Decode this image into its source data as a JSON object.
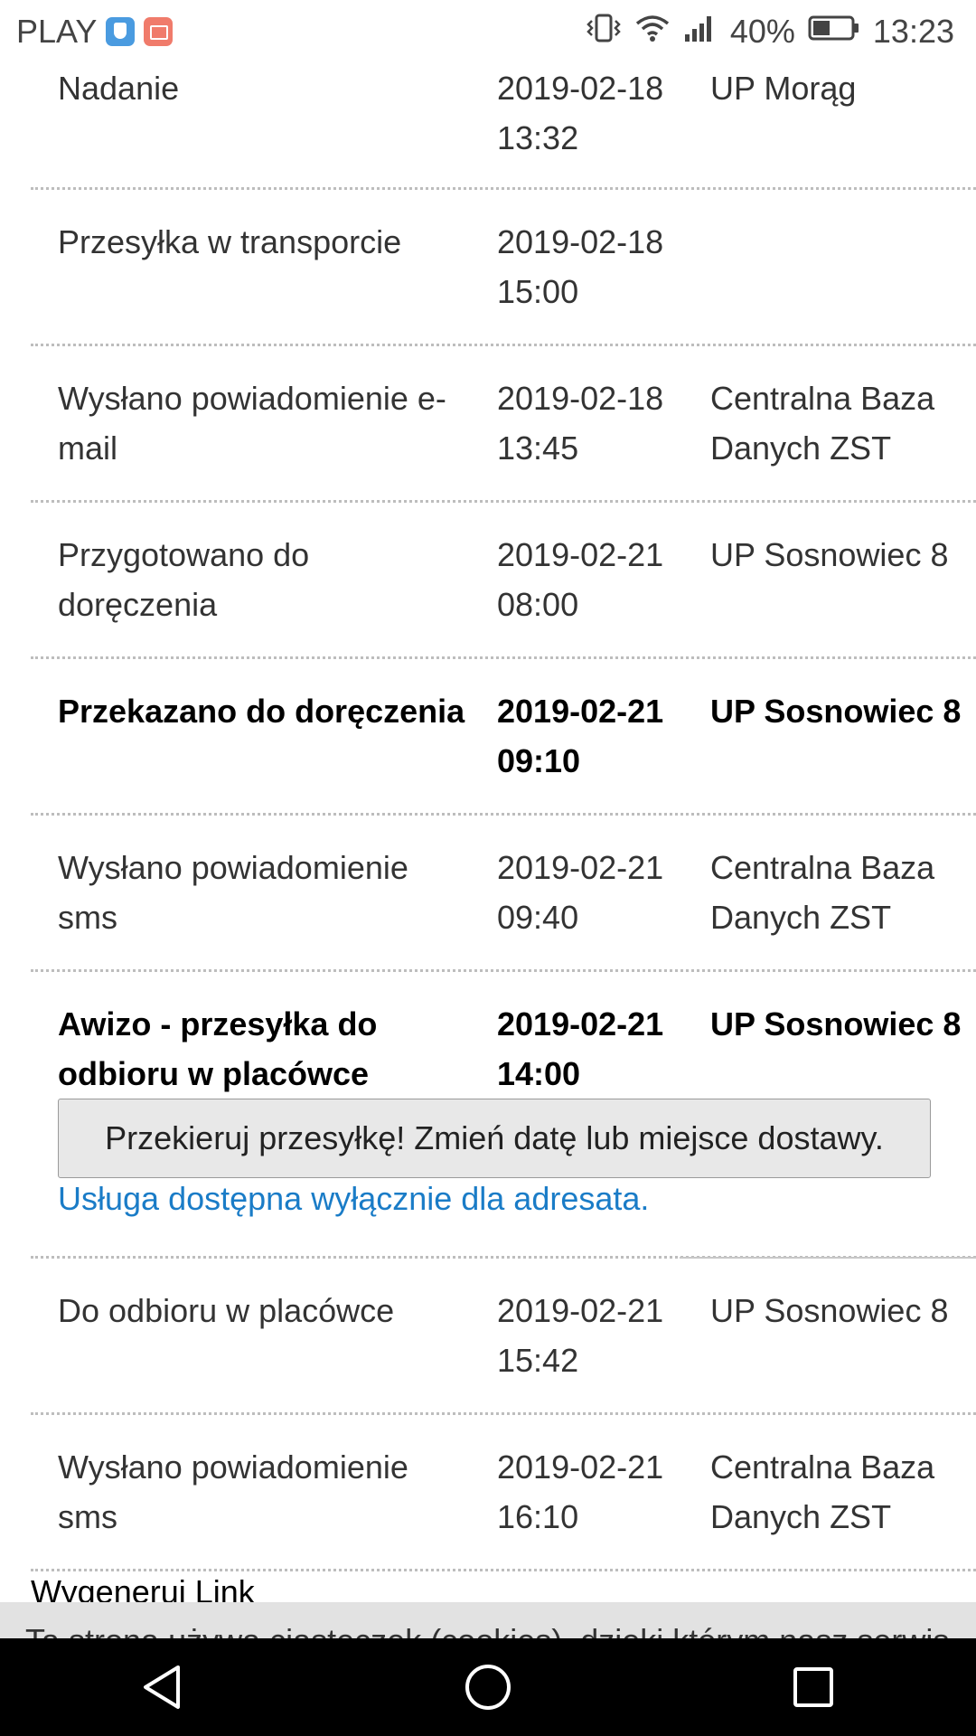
{
  "status_bar": {
    "carrier": "PLAY",
    "battery": "40%",
    "time": "13:23"
  },
  "tracking_events": [
    {
      "description": "Nadanie",
      "date": "2019-02-18 13:32",
      "place": "UP Morąg",
      "bold": false
    },
    {
      "description": "Przesyłka w transporcie",
      "date": "2019-02-18 15:00",
      "place": "",
      "bold": false
    },
    {
      "description": "Wysłano powiadomienie e-mail",
      "date": "2019-02-18 13:45",
      "place": "Centralna Baza Danych ZST",
      "bold": false
    },
    {
      "description": "Przygotowano do doręczenia",
      "date": "2019-02-21 08:00",
      "place": "UP Sosnowiec 8",
      "bold": false
    },
    {
      "description": "Przekazano do doręczenia",
      "date": "2019-02-21 09:10",
      "place": "UP Sosnowiec 8",
      "bold": true
    },
    {
      "description": "Wysłano powiadomienie sms",
      "date": "2019-02-21 09:40",
      "place": "Centralna Baza Danych ZST",
      "bold": false
    },
    {
      "description": "Awizo - przesyłka do odbioru w placówce",
      "date": "2019-02-21 14:00",
      "place": "UP Sosnowiec 8",
      "bold": true
    },
    {
      "description": "Do odbioru w placówce",
      "date": "2019-02-21 15:42",
      "place": "UP Sosnowiec 8",
      "bold": false
    },
    {
      "description": "Wysłano powiadomienie sms",
      "date": "2019-02-21 16:10",
      "place": "Centralna Baza Danych ZST",
      "bold": false
    }
  ],
  "redirect": {
    "button_label": "Przekieruj przesyłkę! Zmień datę lub miejsce dostawy.",
    "note": "Usługa dostępna wyłącznie dla adresata."
  },
  "generate_link": "Wygeneruj Link",
  "cookie_banner": "Ta strona używa ciasteczek (cookies), dzięki którym nasz serwis"
}
